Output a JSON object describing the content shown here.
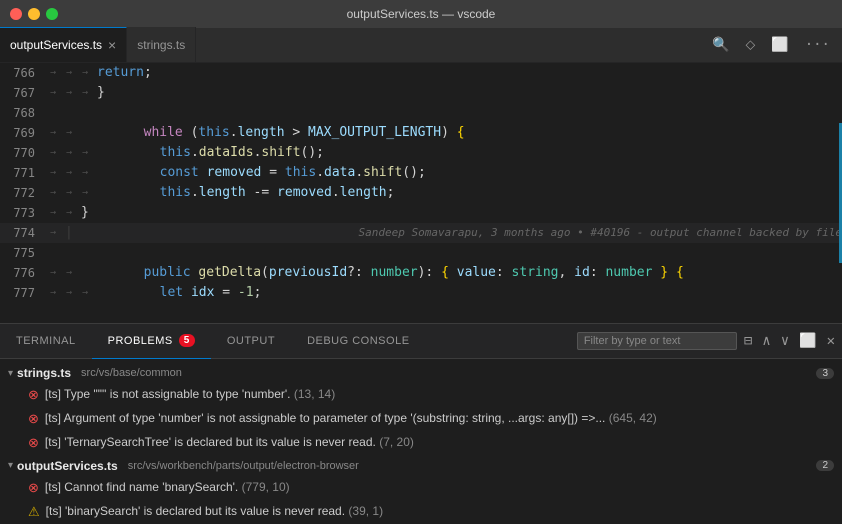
{
  "titleBar": {
    "title": "outputServices.ts — vscode"
  },
  "tabs": [
    {
      "id": "tab-output",
      "label": "outputServices.ts",
      "active": true,
      "closeable": true
    },
    {
      "id": "tab-strings",
      "label": "strings.ts",
      "active": false,
      "closeable": false
    }
  ],
  "tabBarIcons": [
    {
      "id": "split-icon",
      "glyph": "⊕"
    },
    {
      "id": "source-control-icon",
      "glyph": "⬦"
    },
    {
      "id": "layout-icon",
      "glyph": "⬛"
    },
    {
      "id": "more-icon",
      "glyph": "···"
    }
  ],
  "codeLines": [
    {
      "num": "766",
      "indent": 2,
      "content": "return;"
    },
    {
      "num": "767",
      "indent": 2,
      "content": "}"
    },
    {
      "num": "768",
      "indent": 0,
      "content": ""
    },
    {
      "num": "769",
      "indent": 2,
      "content": "while (this.length > MAX_OUTPUT_LENGTH) {"
    },
    {
      "num": "770",
      "indent": 3,
      "content": "this.dataIds.shift();"
    },
    {
      "num": "771",
      "indent": 3,
      "content": "const removed = this.data.shift();"
    },
    {
      "num": "772",
      "indent": 3,
      "content": "this.length -= removed.length;"
    },
    {
      "num": "773",
      "indent": 2,
      "content": "}"
    },
    {
      "num": "774",
      "indent": 0,
      "content": "blame"
    },
    {
      "num": "775",
      "indent": 0,
      "content": ""
    },
    {
      "num": "776",
      "indent": 2,
      "content": "public getDelta(previousId?: number): { value: string, id: number } {"
    },
    {
      "num": "777",
      "indent": 3,
      "content": "let idx = -1;"
    }
  ],
  "blameText": "Sandeep Somavarapu, 3 months ago • #40196 - output channel backed by file",
  "panelTabs": [
    {
      "id": "terminal",
      "label": "TERMINAL",
      "active": false,
      "badge": null
    },
    {
      "id": "problems",
      "label": "PROBLEMS",
      "active": true,
      "badge": "5"
    },
    {
      "id": "output",
      "label": "OUTPUT",
      "active": false,
      "badge": null
    },
    {
      "id": "debug-console",
      "label": "DEBUG CONSOLE",
      "active": false,
      "badge": null
    }
  ],
  "filterPlaceholder": "Filter by type or text",
  "filterValue": "",
  "problemGroups": [
    {
      "file": "strings.ts",
      "path": "src/vs/base/common",
      "badge": "3",
      "problems": [
        {
          "type": "error",
          "text": "[ts] Type '\"\"' is not assignable to type 'number'.",
          "pos": "(13, 14)"
        },
        {
          "type": "error",
          "text": "[ts] Argument of type 'number' is not assignable to parameter of type '(substring: string, ...args: any[]) =>...",
          "pos": "(645, 42)"
        },
        {
          "type": "error",
          "text": "[ts] 'TernarySearchTree' is declared but its value is never read.",
          "pos": "(7, 20)"
        }
      ]
    },
    {
      "file": "outputServices.ts",
      "path": "src/vs/workbench/parts/output/electron-browser",
      "badge": "2",
      "problems": [
        {
          "type": "error",
          "text": "[ts] Cannot find name 'bnarySearch'.",
          "pos": "(779, 10)"
        },
        {
          "type": "warning",
          "text": "[ts] 'binarySearch' is declared but its value is never read.",
          "pos": "(39, 1)"
        }
      ]
    }
  ]
}
